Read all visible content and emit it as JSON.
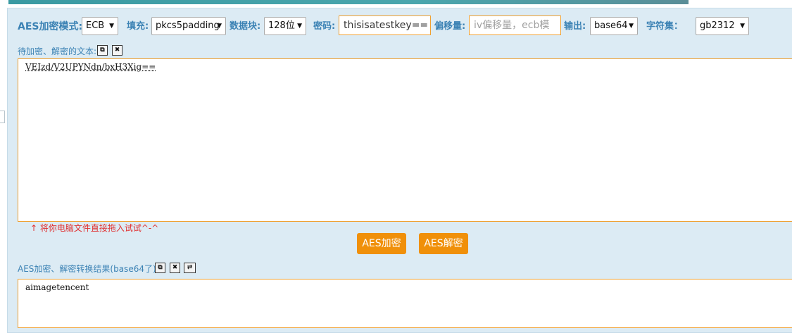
{
  "toolbar": {
    "mode_label": "AES加密模式:",
    "mode_value": "ECB",
    "padding_label": "填充:",
    "padding_value": "pkcs5padding",
    "block_label": "数据块:",
    "block_value": "128位",
    "key_label": "密码:",
    "key_value": "thisisatestkey==",
    "iv_label": "偏移量:",
    "iv_placeholder": "iv偏移量，ecb模",
    "output_label": "输出:",
    "output_value": "base64",
    "charset_label": "字符集：",
    "charset_value": "gb2312"
  },
  "input_section": {
    "label": "待加密、解密的文本:",
    "text": "VEIzd/V2UPYNdn/bxH3Xig==",
    "hint": "↑ 将你电脑文件直接拖入试试^-^"
  },
  "actions": {
    "encrypt_label": "AES加密",
    "decrypt_label": "AES解密"
  },
  "output_section": {
    "label": "AES加密、解密转换结果(base64了):",
    "text": "aimagetencent"
  },
  "icons": {
    "copy": "copy-icon",
    "clear": "clear-icon",
    "swap": "swap-icon"
  },
  "colors": {
    "label": "#3b82b4",
    "accent": "#f0900a",
    "panel_bg": "#dcebf4",
    "hint": "#e03030"
  }
}
